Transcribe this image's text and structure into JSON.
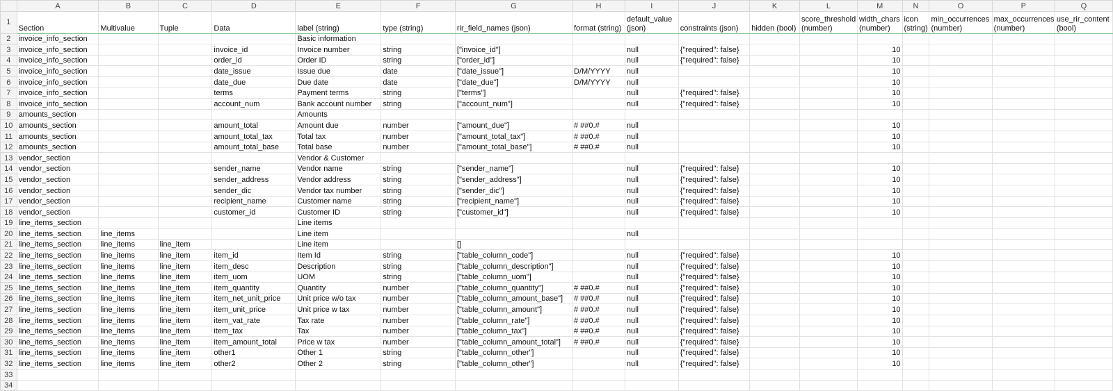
{
  "columns": [
    "A",
    "B",
    "C",
    "D",
    "E",
    "F",
    "G",
    "H",
    "I",
    "J",
    "K",
    "L",
    "M",
    "N",
    "O",
    "P",
    "Q"
  ],
  "header": [
    "Section",
    "Multivalue",
    "Tuple",
    "Data",
    "label (string)",
    "type (string)",
    "rir_field_names (json)",
    "format (string)",
    "default_value (json)",
    "constraints (json)",
    "hidden (bool)",
    "score_threshold (number)",
    "width_chars (number)",
    "icon (string)",
    "min_occurrences (number)",
    "max_occurrences (number)",
    "use_rir_content (bool)"
  ],
  "rows": [
    [
      "invoice_info_section",
      "",
      "",
      "",
      "Basic information",
      "",
      "",
      "",
      "",
      "",
      "",
      "",
      "",
      "",
      "",
      "",
      ""
    ],
    [
      "invoice_info_section",
      "",
      "",
      "invoice_id",
      "Invoice number",
      "string",
      "[\"invoice_id\"]",
      "",
      "null",
      "{\"required\": false}",
      "",
      "",
      "10",
      "",
      "",
      "",
      ""
    ],
    [
      "invoice_info_section",
      "",
      "",
      "order_id",
      "Order ID",
      "string",
      "[\"order_id\"]",
      "",
      "null",
      "{\"required\": false}",
      "",
      "",
      "10",
      "",
      "",
      "",
      ""
    ],
    [
      "invoice_info_section",
      "",
      "",
      "date_issue",
      "Issue due",
      "date",
      "[\"date_issue\"]",
      "D/M/YYYY",
      "null",
      "",
      "",
      "",
      "10",
      "",
      "",
      "",
      ""
    ],
    [
      "invoice_info_section",
      "",
      "",
      "date_due",
      "Due date",
      "date",
      "[\"date_due\"]",
      "D/M/YYYY",
      "null",
      "",
      "",
      "",
      "10",
      "",
      "",
      "",
      ""
    ],
    [
      "invoice_info_section",
      "",
      "",
      "terms",
      "Payment terms",
      "string",
      "[\"terms\"]",
      "",
      "null",
      "{\"required\": false}",
      "",
      "",
      "10",
      "",
      "",
      "",
      ""
    ],
    [
      "invoice_info_section",
      "",
      "",
      "account_num",
      "Bank account number",
      "string",
      "[\"account_num\"]",
      "",
      "null",
      "{\"required\": false}",
      "",
      "",
      "10",
      "",
      "",
      "",
      ""
    ],
    [
      "amounts_section",
      "",
      "",
      "",
      "Amounts",
      "",
      "",
      "",
      "",
      "",
      "",
      "",
      "",
      "",
      "",
      "",
      ""
    ],
    [
      "amounts_section",
      "",
      "",
      "amount_total",
      "Amount due",
      "number",
      "[\"amount_due\"]",
      "# ##0.#",
      "null",
      "",
      "",
      "",
      "10",
      "",
      "",
      "",
      ""
    ],
    [
      "amounts_section",
      "",
      "",
      "amount_total_tax",
      "Total tax",
      "number",
      "[\"amount_total_tax\"]",
      "# ##0.#",
      "null",
      "",
      "",
      "",
      "10",
      "",
      "",
      "",
      ""
    ],
    [
      "amounts_section",
      "",
      "",
      "amount_total_base",
      "Total base",
      "number",
      "[\"amount_total_base\"]",
      "# ##0.#",
      "null",
      "",
      "",
      "",
      "10",
      "",
      "",
      "",
      ""
    ],
    [
      "vendor_section",
      "",
      "",
      "",
      "Vendor & Customer",
      "",
      "",
      "",
      "",
      "",
      "",
      "",
      "",
      "",
      "",
      "",
      ""
    ],
    [
      "vendor_section",
      "",
      "",
      "sender_name",
      "Vendor name",
      "string",
      "[\"sender_name\"]",
      "",
      "null",
      "{\"required\": false}",
      "",
      "",
      "10",
      "",
      "",
      "",
      ""
    ],
    [
      "vendor_section",
      "",
      "",
      "sender_address",
      "Vendor address",
      "string",
      "[\"sender_address\"]",
      "",
      "null",
      "{\"required\": false}",
      "",
      "",
      "10",
      "",
      "",
      "",
      ""
    ],
    [
      "vendor_section",
      "",
      "",
      "sender_dic",
      "Vendor tax number",
      "string",
      "[\"sender_dic\"]",
      "",
      "null",
      "{\"required\": false}",
      "",
      "",
      "10",
      "",
      "",
      "",
      ""
    ],
    [
      "vendor_section",
      "",
      "",
      "recipient_name",
      "Customer name",
      "string",
      "[\"recipient_name\"]",
      "",
      "null",
      "{\"required\": false}",
      "",
      "",
      "10",
      "",
      "",
      "",
      ""
    ],
    [
      "vendor_section",
      "",
      "",
      "customer_id",
      "Customer ID",
      "string",
      "[\"customer_id\"]",
      "",
      "null",
      "{\"required\": false}",
      "",
      "",
      "10",
      "",
      "",
      "",
      ""
    ],
    [
      "line_items_section",
      "",
      "",
      "",
      "Line items",
      "",
      "",
      "",
      "",
      "",
      "",
      "",
      "",
      "",
      "",
      "",
      ""
    ],
    [
      "line_items_section",
      "line_items",
      "",
      "",
      "Line item",
      "",
      "",
      "",
      "null",
      "",
      "",
      "",
      "",
      "",
      "",
      "",
      ""
    ],
    [
      "line_items_section",
      "line_items",
      "line_item",
      "",
      "Line item",
      "",
      "[]",
      "",
      "",
      "",
      "",
      "",
      "",
      "",
      "",
      "",
      ""
    ],
    [
      "line_items_section",
      "line_items",
      "line_item",
      "item_id",
      "Item Id",
      "string",
      "[\"table_column_code\"]",
      "",
      "null",
      "{\"required\": false}",
      "",
      "",
      "10",
      "",
      "",
      "",
      ""
    ],
    [
      "line_items_section",
      "line_items",
      "line_item",
      "item_desc",
      "Description",
      "string",
      "[\"table_column_description\"]",
      "",
      "null",
      "{\"required\": false}",
      "",
      "",
      "10",
      "",
      "",
      "",
      ""
    ],
    [
      "line_items_section",
      "line_items",
      "line_item",
      "item_uom",
      "UOM",
      "string",
      "[\"table_column_uom\"]",
      "",
      "null",
      "{\"required\": false}",
      "",
      "",
      "10",
      "",
      "",
      "",
      ""
    ],
    [
      "line_items_section",
      "line_items",
      "line_item",
      "item_quantity",
      "Quantity",
      "number",
      "[\"table_column_quantity\"]",
      "# ##0.#",
      "null",
      "{\"required\": false}",
      "",
      "",
      "10",
      "",
      "",
      "",
      ""
    ],
    [
      "line_items_section",
      "line_items",
      "line_item",
      "item_net_unit_price",
      "Unit price w/o tax",
      "number",
      "[\"table_column_amount_base\"]",
      "# ##0.#",
      "null",
      "{\"required\": false}",
      "",
      "",
      "10",
      "",
      "",
      "",
      ""
    ],
    [
      "line_items_section",
      "line_items",
      "line_item",
      "item_unit_price",
      "Unit price w tax",
      "number",
      "[\"table_column_amount\"]",
      "# ##0.#",
      "null",
      "{\"required\": false}",
      "",
      "",
      "10",
      "",
      "",
      "",
      ""
    ],
    [
      "line_items_section",
      "line_items",
      "line_item",
      "item_vat_rate",
      "Tax rate",
      "number",
      "[\"table_column_rate\"]",
      "# ##0.#",
      "null",
      "{\"required\": false}",
      "",
      "",
      "10",
      "",
      "",
      "",
      ""
    ],
    [
      "line_items_section",
      "line_items",
      "line_item",
      "item_tax",
      "Tax",
      "number",
      "[\"table_column_tax\"]",
      "# ##0.#",
      "null",
      "{\"required\": false}",
      "",
      "",
      "10",
      "",
      "",
      "",
      ""
    ],
    [
      "line_items_section",
      "line_items",
      "line_item",
      "item_amount_total",
      "Price w tax",
      "number",
      "[\"table_column_amount_total\"]",
      "# ##0.#",
      "null",
      "{\"required\": false}",
      "",
      "",
      "10",
      "",
      "",
      "",
      ""
    ],
    [
      "line_items_section",
      "line_items",
      "line_item",
      "other1",
      "Other 1",
      "string",
      "[\"table_column_other\"]",
      "",
      "null",
      "{\"required\": false}",
      "",
      "",
      "10",
      "",
      "",
      "",
      ""
    ],
    [
      "line_items_section",
      "line_items",
      "line_item",
      "other2",
      "Other 2",
      "string",
      "[\"table_column_other\"]",
      "",
      "null",
      "{\"required\": false}",
      "",
      "",
      "10",
      "",
      "",
      "",
      ""
    ],
    [
      "",
      "",
      "",
      "",
      "",
      "",
      "",
      "",
      "",
      "",
      "",
      "",
      "",
      "",
      "",
      "",
      ""
    ],
    [
      "",
      "",
      "",
      "",
      "",
      "",
      "",
      "",
      "",
      "",
      "",
      "",
      "",
      "",
      "",
      "",
      ""
    ]
  ],
  "colors": {
    "header_bg": "#f4f4f4",
    "grid": "#e2e2e2",
    "accent_border": "#7bbf8a"
  }
}
